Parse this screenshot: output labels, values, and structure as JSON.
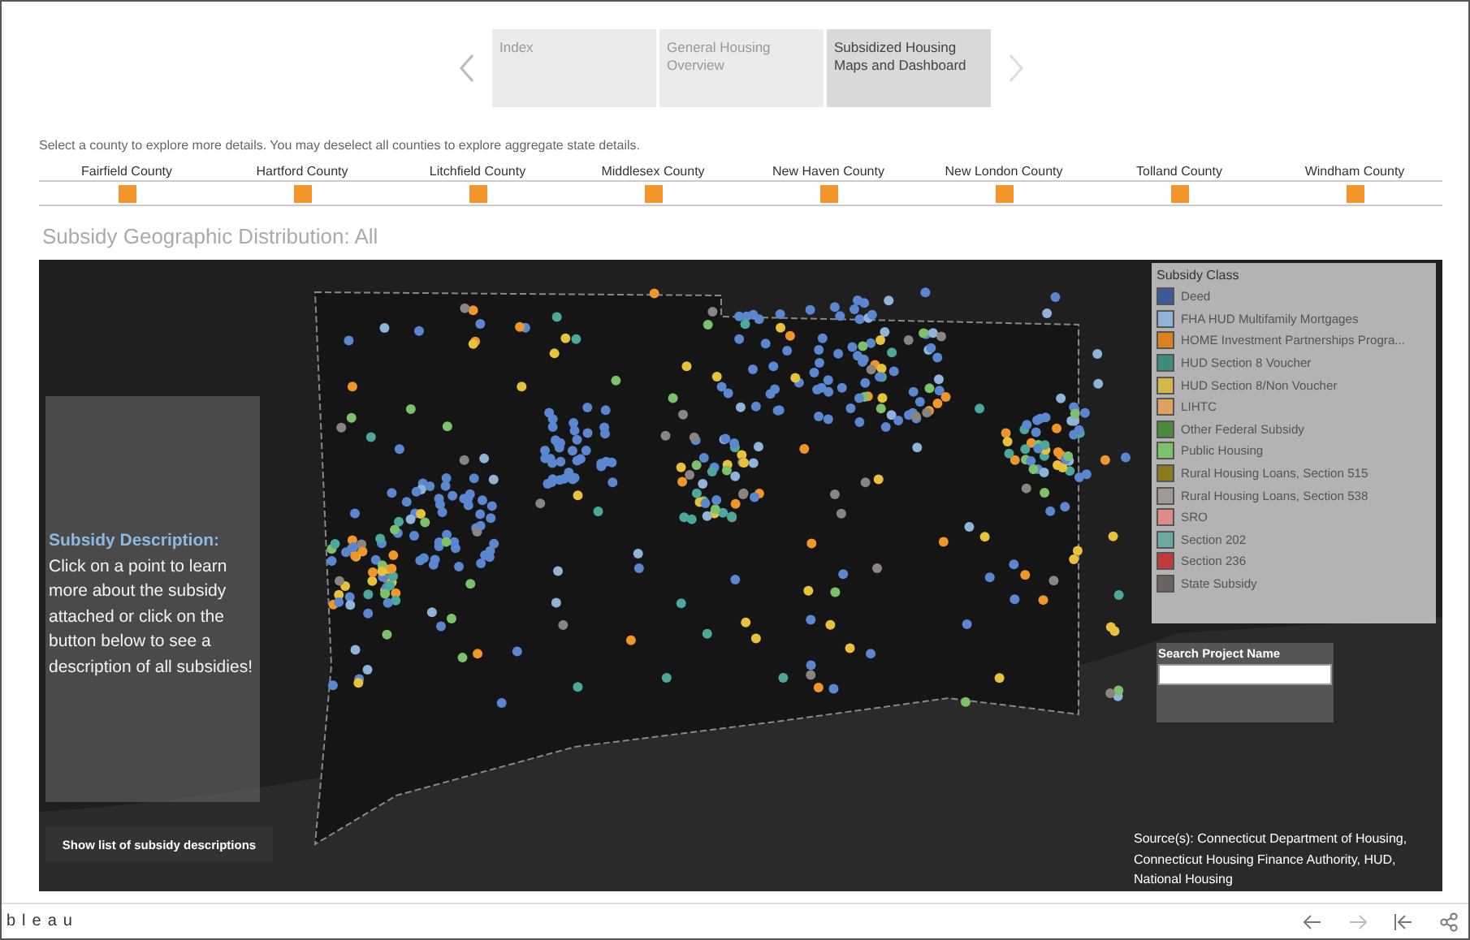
{
  "nav": {
    "tabs": [
      {
        "label": "Index",
        "selected": false
      },
      {
        "label": "General Housing Overview",
        "selected": false
      },
      {
        "label": "Subsidized Housing Maps and Dashboard",
        "selected": true
      }
    ]
  },
  "instructions": "Select a county to explore more details. You may deselect all counties to explore aggregate state details.",
  "counties": [
    "Fairfield County",
    "Hartford County",
    "Litchfield County",
    "Middlesex County",
    "New Haven County",
    "New London County",
    "Tolland County",
    "Windham County"
  ],
  "title": "Subsidy Geographic Distribution: All",
  "map": {
    "description": {
      "heading": "Subsidy Description:",
      "body": "Click on a point to learn more about the subsidy attached or click on the button below to see a description of all subsidies!"
    },
    "button": "Show list of subsidy descriptions",
    "legend": {
      "title": "Subsidy Class",
      "items": [
        {
          "label": "Deed",
          "color": "#3a5c99"
        },
        {
          "label": "FHA HUD Multifamily Mortgages",
          "color": "#8fb3d9"
        },
        {
          "label": "HOME Investment Partnerships Progra...",
          "color": "#d9821e"
        },
        {
          "label": "HUD Section 8 Voucher",
          "color": "#3d8c80"
        },
        {
          "label": "HUD Section 8/Non Voucher",
          "color": "#d4b94a"
        },
        {
          "label": "LIHTC",
          "color": "#e0a060"
        },
        {
          "label": "Other Federal Subsidy",
          "color": "#4a8c3a"
        },
        {
          "label": "Public Housing",
          "color": "#7cc26a"
        },
        {
          "label": "Rural Housing Loans, Section 515",
          "color": "#8c7a1e"
        },
        {
          "label": "Rural Housing Loans, Section 538",
          "color": "#a39a95"
        },
        {
          "label": "SRO",
          "color": "#e08a8a"
        },
        {
          "label": "Section 202",
          "color": "#6aa8a0"
        },
        {
          "label": "Section 236",
          "color": "#c23a3a"
        },
        {
          "label": "State Subsidy",
          "color": "#6b6360"
        }
      ]
    },
    "search": {
      "label": "Search Project Name"
    },
    "source": "Source(s): Connecticut Department of Housing, Connecticut Housing Finance Authority, HUD, National Housing"
  },
  "footer": {
    "logo": "bleau"
  }
}
